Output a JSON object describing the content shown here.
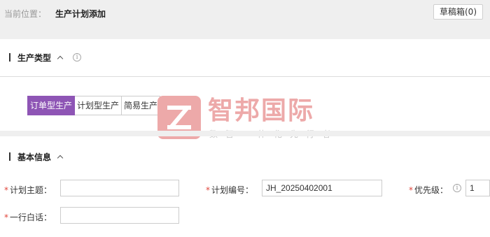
{
  "breadcrumb": {
    "label": "当前位置：",
    "current": "生产计划添加"
  },
  "toolbar": {
    "draft_label": "草稿箱(0)"
  },
  "section_type": {
    "title": "生产类型"
  },
  "tabs": [
    {
      "label": "订单型生产",
      "active": true
    },
    {
      "label": "计划型生产",
      "active": false
    },
    {
      "label": "简易生产",
      "active": false
    }
  ],
  "section_basic": {
    "title": "基本信息"
  },
  "form": {
    "required_mark": "*",
    "plan_subject": {
      "label": "计划主题：",
      "value": ""
    },
    "plan_number": {
      "label": "计划编号：",
      "value": "JH_20250402001"
    },
    "priority": {
      "label": "优先级：",
      "value": "1"
    },
    "one_line_note": {
      "label": "一行白话：",
      "value": ""
    }
  },
  "watermark": {
    "title": "智邦国际",
    "subtitle": "数智一体化先行者"
  },
  "colors": {
    "accent": "#8e55b5",
    "required": "#e0453b",
    "watermark": "#eda9a9"
  }
}
